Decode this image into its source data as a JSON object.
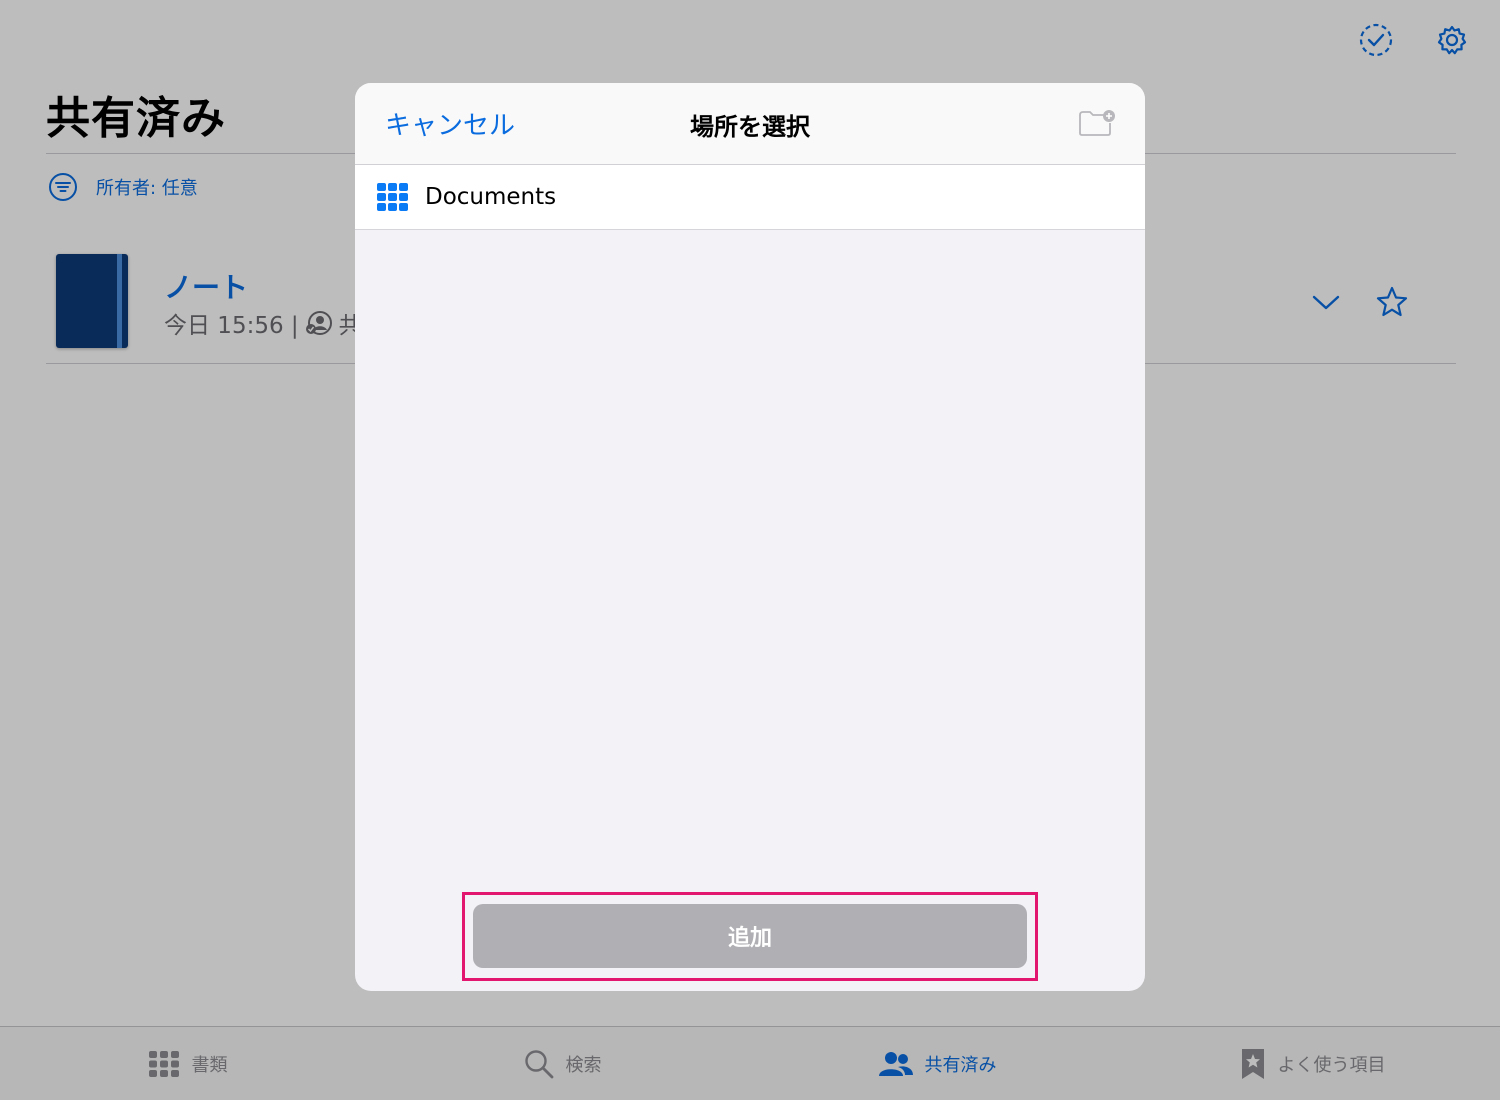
{
  "page": {
    "title": "共有済み",
    "filter_label": "所有者: 任意",
    "document": {
      "name": "ノート",
      "meta_time": "今日 15:56 |",
      "meta_shared": "共"
    }
  },
  "tabbar": {
    "tabs": [
      {
        "label": "書類",
        "icon": "grid-icon",
        "active": false
      },
      {
        "label": "検索",
        "icon": "search-icon",
        "active": false
      },
      {
        "label": "共有済み",
        "icon": "people-icon",
        "active": true
      },
      {
        "label": "よく使う項目",
        "icon": "bookmark-star-icon",
        "active": false
      }
    ]
  },
  "modal": {
    "cancel_label": "キャンセル",
    "title": "場所を選択",
    "folder_label": "Documents",
    "add_label": "追加"
  },
  "colors": {
    "accent": "#0a6cdf",
    "highlight": "#e3166f",
    "disabled_button": "#b0b0b4"
  }
}
